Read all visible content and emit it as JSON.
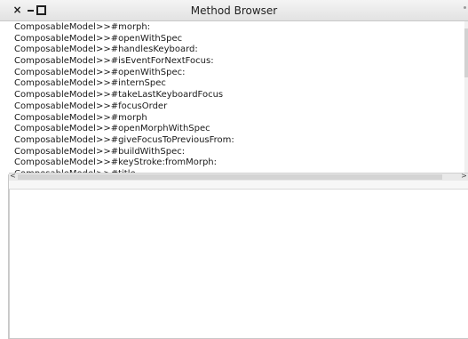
{
  "window": {
    "title": "Method Browser",
    "controls": {
      "close": "×",
      "minimize": "−",
      "maximize": "□"
    }
  },
  "methods": [
    "ComposableModel>>#morph:",
    "ComposableModel>>#openWithSpec",
    "ComposableModel>>#handlesKeyboard:",
    "ComposableModel>>#isEventForNextFocus:",
    "ComposableModel>>#openWithSpec:",
    "ComposableModel>>#internSpec",
    "ComposableModel>>#takeLastKeyboardFocus",
    "ComposableModel>>#focusOrder",
    "ComposableModel>>#morph",
    "ComposableModel>>#openMorphWithSpec",
    "ComposableModel>>#giveFocusToPreviousFrom:",
    "ComposableModel>>#buildWithSpec:",
    "ComposableModel>>#keyStroke:fromMorph:",
    "ComposableModel>>#title"
  ],
  "scrollbar": {
    "left_arrow": "<",
    "right_arrow": ">"
  },
  "source": {
    "text": ""
  }
}
